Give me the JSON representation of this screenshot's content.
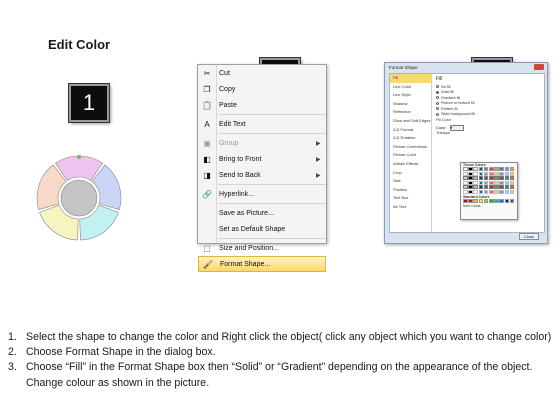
{
  "title": "Edit Color",
  "steps": [
    "1",
    "2",
    "3"
  ],
  "wheel": {
    "segment_colors": [
      "#eec3f0",
      "#c8d5f5",
      "#c3f0f0",
      "#f5f5c0",
      "#f6d9c6"
    ],
    "center_color": "#c4c4c4",
    "handle_color": "#6bbf50"
  },
  "context_menu": {
    "items": [
      {
        "label": "Cut",
        "icon": "scissors-icon",
        "glyph": "✂",
        "disabled": false,
        "submenu": false
      },
      {
        "label": "Copy",
        "icon": "copy-icon",
        "glyph": "❐",
        "disabled": false,
        "submenu": false
      },
      {
        "label": "Paste",
        "icon": "paste-icon",
        "glyph": "📋",
        "disabled": false,
        "submenu": false
      },
      {
        "label": "Edit Text",
        "icon": "edit-text-icon",
        "glyph": "A",
        "disabled": false,
        "submenu": false
      },
      {
        "label": "Group",
        "icon": "group-icon",
        "glyph": "▣",
        "disabled": true,
        "submenu": true
      },
      {
        "label": "Bring to Front",
        "icon": "bring-to-front-icon",
        "glyph": "◧",
        "disabled": false,
        "submenu": true
      },
      {
        "label": "Send to Back",
        "icon": "send-to-back-icon",
        "glyph": "◨",
        "disabled": false,
        "submenu": true
      },
      {
        "label": "Hyperlink...",
        "icon": "hyperlink-icon",
        "glyph": "🔗",
        "disabled": false,
        "submenu": false
      },
      {
        "label": "Save as Picture...",
        "icon": "",
        "glyph": "",
        "disabled": false,
        "submenu": false
      },
      {
        "label": "Set as Default Shape",
        "icon": "",
        "glyph": "",
        "disabled": false,
        "submenu": false
      },
      {
        "label": "Size and Position...",
        "icon": "size-position-icon",
        "glyph": "⬚",
        "disabled": false,
        "submenu": false
      },
      {
        "label": "Format Shape...",
        "icon": "format-shape-icon",
        "glyph": "🖌",
        "disabled": false,
        "submenu": false,
        "active": true
      }
    ]
  },
  "dialog": {
    "title": "Format Shape",
    "left_items": [
      "Fill",
      "Line Color",
      "Line Style",
      "Shadow",
      "Reflection",
      "Glow and Soft Edges",
      "3-D Format",
      "3-D Rotation",
      "Picture Corrections",
      "Picture Color",
      "Artistic Effects",
      "Crop",
      "Size",
      "Position",
      "Text Box",
      "Alt Text"
    ],
    "selected_index": 0,
    "heading": "Fill",
    "options": [
      {
        "label": "No fill",
        "on": false
      },
      {
        "label": "Solid fill",
        "on": true
      },
      {
        "label": "Gradient fill",
        "on": false
      },
      {
        "label": "Picture or texture fill",
        "on": false
      },
      {
        "label": "Pattern fill",
        "on": false
      },
      {
        "label": "Slide background fill",
        "on": false
      }
    ],
    "fill_color_label": "Fill Color",
    "color_label": "Color:",
    "transparency_label": "Transpa",
    "theme_colors_label": "Theme Colors",
    "standard_colors_label": "Standard Colors",
    "more_colors_label": "More Colors...",
    "close_label": "Close",
    "theme_palette": [
      "#ffffff",
      "#000000",
      "#eeece1",
      "#1f497d",
      "#4f81bd",
      "#c0504d",
      "#9bbb59",
      "#8064a2",
      "#4bacc6",
      "#f79646"
    ],
    "standard_palette": [
      "#c00000",
      "#ff0000",
      "#ffc000",
      "#ffff00",
      "#92d050",
      "#00b050",
      "#00b0f0",
      "#0070c0",
      "#002060",
      "#7030a0"
    ]
  },
  "instructions": [
    {
      "num": "1.",
      "text": "Select the shape to change the color and Right click the object( click any object which you want to change color)"
    },
    {
      "num": "2.",
      "text": "Choose Format Shape in the dialog box."
    },
    {
      "num": "3.",
      "text": "Choose “Fill” in the Format Shape box then “Solid” or “Gradient” depending on the appearance of the object. Change colour as shown in the picture."
    }
  ]
}
